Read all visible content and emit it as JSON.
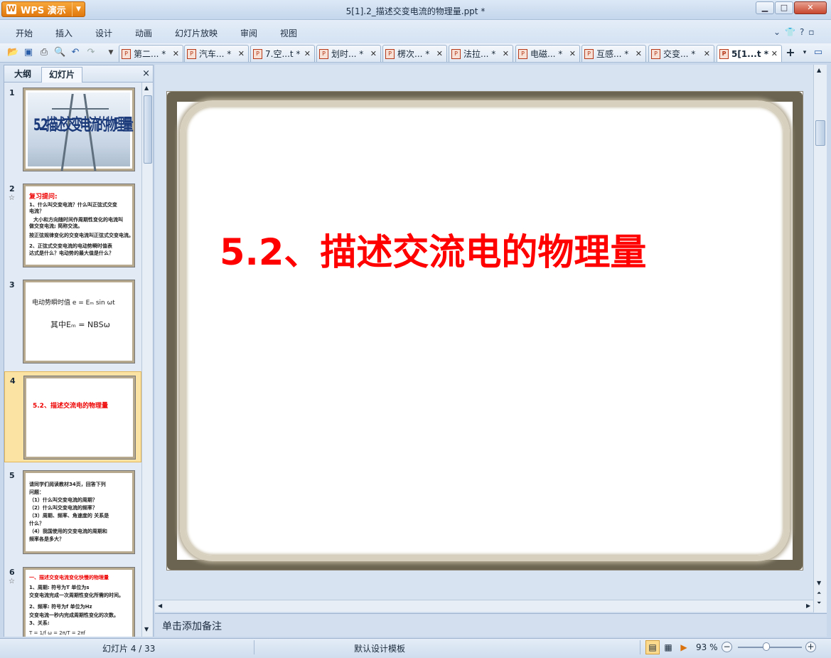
{
  "titlebar": {
    "app_name": "WPS 演示",
    "app_logo": "W",
    "doc_title": "5[1].2_描述交变电流的物理量.ppt *"
  },
  "menu": [
    "开始",
    "插入",
    "设计",
    "动画",
    "幻灯片放映",
    "审阅",
    "视图"
  ],
  "menu_right_icons": [
    "chevron-down-icon",
    "shirt-icon",
    "help-icon",
    "restore-icon"
  ],
  "toolbar_icons": [
    "open-icon",
    "save-icon",
    "print-icon",
    "print-preview-icon",
    "undo-icon",
    "redo-icon",
    "dropdown-icon"
  ],
  "doc_tabs": [
    {
      "label": "第二... *",
      "active": false
    },
    {
      "label": "汽车... *",
      "active": false
    },
    {
      "label": "7.空...t *",
      "active": false
    },
    {
      "label": "划时... *",
      "active": false
    },
    {
      "label": "楞次... *",
      "active": false
    },
    {
      "label": "法拉... *",
      "active": false
    },
    {
      "label": "电磁... *",
      "active": false
    },
    {
      "label": "互感... *",
      "active": false
    },
    {
      "label": "交变... *",
      "active": false
    },
    {
      "label": "5[1...t *",
      "active": true
    }
  ],
  "left_panel": {
    "tab_outline": "大纲",
    "tab_slides": "幻灯片",
    "close": "×"
  },
  "thumbnails": [
    {
      "num": "1",
      "title": "5.2描述交变电流的物理量"
    },
    {
      "num": "2",
      "star": "☆",
      "lines": [
        "复习提问:",
        "1、什么叫交变电流？什么叫正弦式交变",
        "电流？",
        "大小和方向随时间作周期性变化的电流叫",
        "做交变电流; 简称交流。",
        "按正弦规律变化的交变电流叫正弦式交变电流。",
        "2、正弦式交变电流的电动势瞬时值表",
        "达式是什么？电动势的最大值是什么？"
      ]
    },
    {
      "num": "3",
      "lines": [
        "电动势瞬时值   e = Eₘ sin ωt",
        "其中Eₘ = NBSω"
      ]
    },
    {
      "num": "4",
      "selected": true,
      "lines": [
        "5.2、描述交流电的物理量"
      ]
    },
    {
      "num": "5",
      "lines": [
        "请同学们阅读教材34页，回答下列",
        "问题：",
        "（1）什么叫交变电流的周期？",
        "（2）什么叫交变电流的频率？",
        "（3）周期、频率、角速度的 关系是",
        "什么？",
        "（4）我国使用的交变电流的周期和",
        "频率各是多大？"
      ]
    },
    {
      "num": "6",
      "star": "☆",
      "lines": [
        "一、描述交变电流变化快慢的物理量",
        "1、周期:   符号为T  单位为s",
        "交变电流完成一次周期性变化所需的时间。",
        "2、频率:     符号为f  单位为Hz",
        "交变电流一秒内完成周期性变化的次数。",
        "3、关系:",
        "T = 1/f    ω = 2π/T = 2πf"
      ]
    }
  ],
  "slide": {
    "title": "5.2、描述交流电的物理量",
    "title_color": "#ff0000"
  },
  "notes": {
    "placeholder": "单击添加备注"
  },
  "status": {
    "slide_indicator": "幻灯片 4 / 33",
    "template": "默认设计模板",
    "zoom": "93 %",
    "zoom_fraction": 0.5
  }
}
